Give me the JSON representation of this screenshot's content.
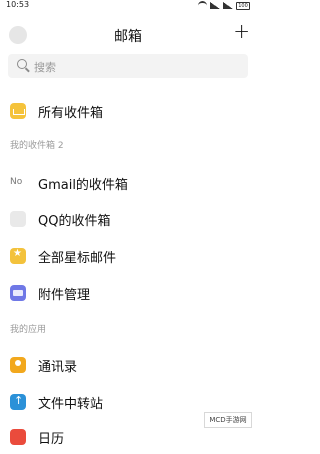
{
  "status_bar": {
    "time": "10:53",
    "battery": "100"
  },
  "header": {
    "title": "邮箱",
    "add_icon": "+"
  },
  "search": {
    "placeholder": "搜索"
  },
  "all_inboxes": {
    "label": "所有收件箱"
  },
  "my_inboxes": {
    "section_title": "我的收件箱 2",
    "items": [
      {
        "label": "Gmail的收件箱",
        "icon_text": "No"
      },
      {
        "label": "QQ的收件箱"
      },
      {
        "label": "全部星标邮件"
      },
      {
        "label": "附件管理"
      }
    ]
  },
  "my_apps": {
    "section_title": "我的应用",
    "items": [
      {
        "label": "通讯录"
      },
      {
        "label": "文件中转站"
      },
      {
        "label": "日历"
      }
    ]
  },
  "watermark": {
    "text": "MCD手游网"
  },
  "colors": {
    "star": "#f3c23c",
    "attach": "#6f78e6",
    "transfer": "#2b91d8",
    "calendar": "#ea4b3c"
  }
}
